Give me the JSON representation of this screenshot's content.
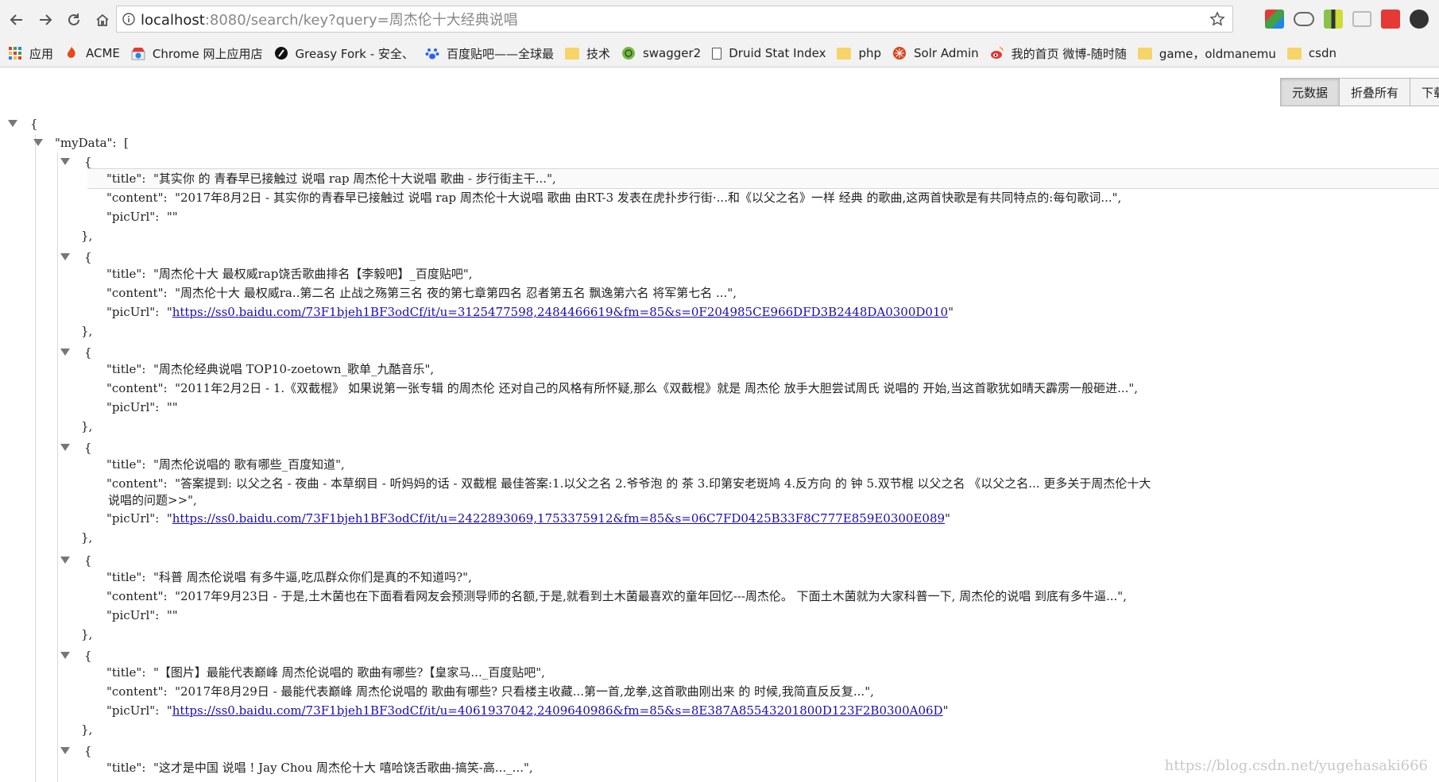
{
  "browser": {
    "url_host": "localhost",
    "url_rest": ":8080/search/key?query=周杰伦十大经典说唱"
  },
  "bookmarks": [
    {
      "label": "应用",
      "icon": "apps-grid-icon"
    },
    {
      "label": "ACME",
      "icon": "acme-icon"
    },
    {
      "label": "Chrome 网上应用店",
      "icon": "webstore-icon"
    },
    {
      "label": "Greasy Fork - 安全、",
      "icon": "greasyfork-icon"
    },
    {
      "label": "百度贴吧——全球最",
      "icon": "baidu-paw-icon"
    },
    {
      "label": "技术",
      "icon": "folder-icon"
    },
    {
      "label": "swagger2",
      "icon": "swagger-icon"
    },
    {
      "label": "Druid Stat Index",
      "icon": "page-icon"
    },
    {
      "label": "php",
      "icon": "folder-icon"
    },
    {
      "label": "Solr Admin",
      "icon": "solr-icon"
    },
    {
      "label": "我的首页 微博-随时随",
      "icon": "weibo-icon"
    },
    {
      "label": "game，oldmanemu",
      "icon": "folder-icon"
    },
    {
      "label": "csdn",
      "icon": "folder-icon"
    }
  ],
  "viewer": {
    "raw_label": "元数据",
    "collapse_label": "折叠所有",
    "download_label": "下载"
  },
  "json": {
    "open_brace": "{",
    "root_key": "\"myData\"",
    "colon": ":",
    "open_bracket": "[",
    "items": [
      {
        "title": "\"其实你 的 青春早已接触过 说唱 rap 周杰伦十大说唱 歌曲 - 步行街主干...\",",
        "content": "\"2017年8月2日  -   其实你的青春早已接触过 说唱 rap 周杰伦十大说唱 歌曲 由RT-3 发表在虎扑步行街·...和《以父之名》一样 经典 的歌曲,这两首快歌是有共同特点的:每句歌词...\",",
        "picUrl_text": "\"\"",
        "picUrl_link": ""
      },
      {
        "title": "\"周杰伦十大 最权威rap饶舌歌曲排名【李毅吧】_百度贴吧\",",
        "content": "\"周杰伦十大 最权威ra..第二名 止战之殇第三名 夜的第七章第四名 忍者第五名 飘逸第六名 将军第七名 ...\",",
        "picUrl_text": "",
        "picUrl_link": "https://ss0.baidu.com/73F1bjeh1BF3odCf/it/u=3125477598,2484466619&fm=85&s=0F204985CE966DFD3B2448DA0300D010"
      },
      {
        "title": "\"周杰伦经典说唱 TOP10-zoetown_歌单_九酷音乐\",",
        "content": "\"2011年2月2日  -   1.《双截棍》 如果说第一张专辑 的周杰伦 还对自己的风格有所怀疑,那么《双截棍》就是 周杰伦 放手大胆尝试周氏 说唱的 开始,当这首歌犹如晴天霹雳一般砸进...\",",
        "picUrl_text": "\"\"",
        "picUrl_link": ""
      },
      {
        "title": "\"周杰伦说唱的 歌有哪些_百度知道\",",
        "content": "\"答案提到:    以父之名   -   夜曲   -   本草纲目   -   听妈妈的话   -   双截棍 最佳答案:1.以父之名 2.爷爷泡 的 茶 3.印第安老斑鸠 4.反方向 的 钟 5.双节棍 以父之名 《以父之名... 更多关于周杰伦十大",
        "content_cont": "说唱的问题>>\",",
        "picUrl_text": "",
        "picUrl_link": "https://ss0.baidu.com/73F1bjeh1BF3odCf/it/u=2422893069,1753375912&fm=85&s=06C7FD0425B33F8C777E859E0300E089"
      },
      {
        "title": "\"科普 周杰伦说唱 有多牛逼,吃瓜群众你们是真的不知道吗?\",",
        "content": "\"2017年9月23日  -   于是,土木菌也在下面看看网友会预测导师的名额,于是,就看到土木菌最喜欢的童年回忆---周杰伦。 下面土木菌就为大家科普一下, 周杰伦的说唱 到底有多牛逼...\",",
        "picUrl_text": "\"\"",
        "picUrl_link": ""
      },
      {
        "title": "\"【图片】最能代表巅峰 周杰伦说唱的 歌曲有哪些?【皇家马..._百度贴吧\",",
        "content": "\"2017年8月29日  -   最能代表巅峰 周杰伦说唱的 歌曲有哪些? 只看楼主收藏...第一首,龙拳,这首歌曲刚出来 的 时候,我简直反反复...\",",
        "picUrl_text": "",
        "picUrl_link": "https://ss0.baidu.com/73F1bjeh1BF3odCf/it/u=4061937042,2409640986&fm=85&s=8E387A85543201800D123F2B0300A06D"
      },
      {
        "title": "\"这才是中国 说唱 ! Jay Chou 周杰伦十大 嘻哈饶舌歌曲-搞笑-高..._...\","
      }
    ],
    "key_title": "\"title\":",
    "key_content": "\"content\":",
    "key_picUrl": "\"picUrl\":",
    "item_open": "{",
    "item_close": "},",
    "quote": "\"",
    "quote_comma": "\","
  },
  "watermark": "https://blog.csdn.net/yugehasaki666"
}
